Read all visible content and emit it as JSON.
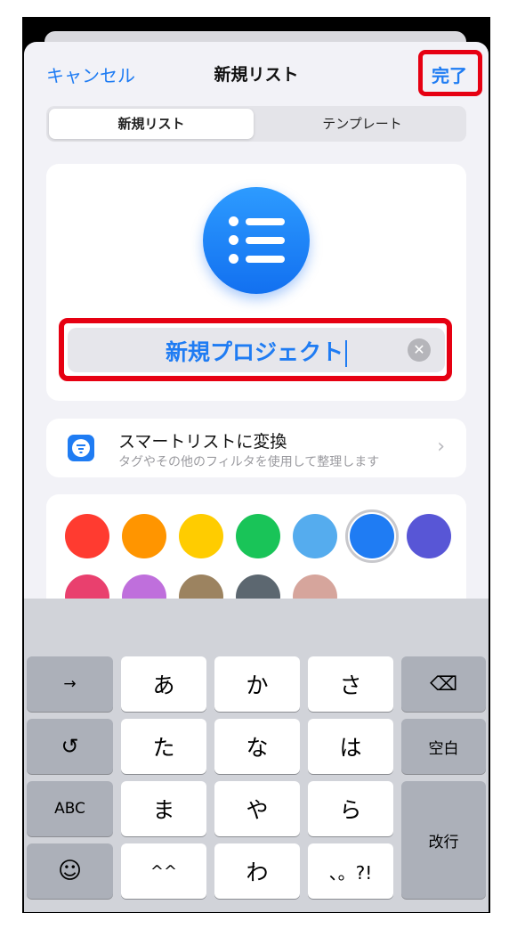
{
  "nav": {
    "cancel_label": "キャンセル",
    "title": "新規リスト",
    "done_label": "完了"
  },
  "segment": {
    "tabs": [
      "新規リスト",
      "テンプレート"
    ],
    "selected": "新規リスト"
  },
  "list_icon": {
    "icon": "list-bullet-icon",
    "color": "#1f7cf3"
  },
  "name_field": {
    "value": "新規プロジェクト",
    "clear_icon": "clear-icon"
  },
  "smart_list": {
    "title": "スマートリストに変換",
    "subtitle": "タグやその他のフィルタを使用して整理します",
    "icon": "filter-icon"
  },
  "colors": {
    "row1": [
      "#ff3b30",
      "#ff9500",
      "#ffcc00",
      "#19c458",
      "#55acee",
      "#1f7cf3",
      "#5856d6"
    ],
    "row2": [
      "#e9406e",
      "#bf6fdc",
      "#9c8360",
      "#5c6770",
      "#d6a59c"
    ],
    "selected": "#1f7cf3"
  },
  "highlight_color": "#e60012",
  "keyboard": {
    "row1": [
      "→",
      "あ",
      "か",
      "さ",
      "⌫"
    ],
    "row2": [
      "↺",
      "た",
      "な",
      "は",
      "空白"
    ],
    "row3": [
      "ABC",
      "ま",
      "や",
      "ら",
      "改行"
    ],
    "row4": [
      "☺",
      "^^",
      "わ",
      "、。?!"
    ]
  }
}
